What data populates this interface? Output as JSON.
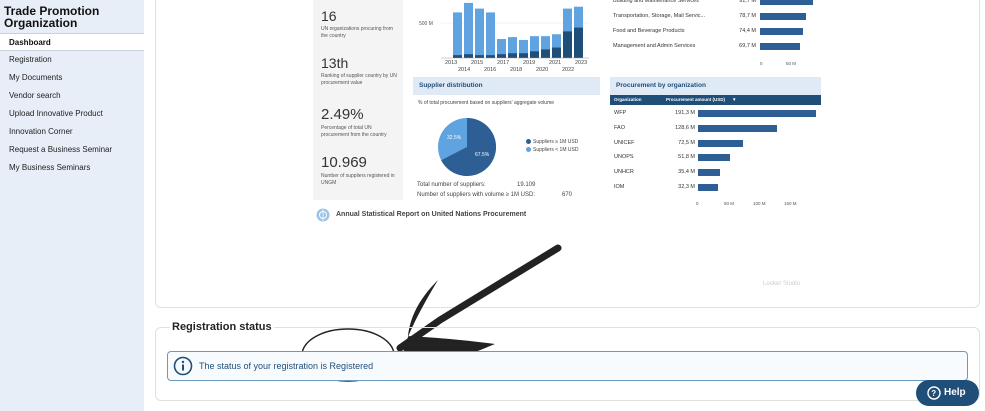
{
  "sidebar": {
    "org_title": "Trade Promotion Organization",
    "items": [
      {
        "label": "Dashboard",
        "active": true
      },
      {
        "label": "Registration"
      },
      {
        "label": "My Documents"
      },
      {
        "label": "Vendor search"
      },
      {
        "label": "Upload Innovative Product"
      },
      {
        "label": "Innovation Corner"
      },
      {
        "label": "Request a Business Seminar"
      },
      {
        "label": "My Business Seminars"
      }
    ]
  },
  "kpis": [
    {
      "value": "16",
      "desc": "UN organizations procuring from the country"
    },
    {
      "value": "13th",
      "desc": "Ranking of supplier country by UN procurement value"
    },
    {
      "value": "2.49%",
      "desc": "Percentage of total UN procurement from the country"
    },
    {
      "value": "10.969",
      "desc": "Number of suppliers registered in UNGM"
    }
  ],
  "year_chart": {
    "y_tick": "500 M",
    "x_top": [
      "2013",
      "2015",
      "2017",
      "2019",
      "2021",
      "2023"
    ],
    "x_bottom": [
      "2014",
      "2016",
      "2018",
      "2020",
      "2022"
    ]
  },
  "supplier_distribution": {
    "title": "Supplier distribution",
    "subtitle": "% of total procurement based on suppliers' aggregate volume",
    "pie_small": "32.5%",
    "pie_large": "67.5%",
    "legend": [
      "Suppliers ≥ 1M USD",
      "Suppliers < 1M USD"
    ],
    "total_label": "Total number of suppliers:",
    "total_value": "19.109",
    "over_label": "Number of suppliers with volume ≥ 1M USD:",
    "over_value": "670",
    "colors": {
      "large": "#2d5e94",
      "small": "#5fa3e0"
    }
  },
  "categories_chart": {
    "rows": [
      {
        "label": "Building and Maintenance Services",
        "value": "91,7 M",
        "num": 91.7
      },
      {
        "label": "Transportation, Storage, Mail Servic...",
        "value": "78,7 M",
        "num": 78.7
      },
      {
        "label": "Food and Beverage Products",
        "value": "74,4 M",
        "num": 74.4
      },
      {
        "label": "Management and Admin Services",
        "value": "69,7 M",
        "num": 69.7
      }
    ],
    "ticks": [
      "0",
      "50 M"
    ]
  },
  "org_chart": {
    "title": "Procurement by organization",
    "col_org": "Organization",
    "col_amount": "Procurement amount (USD)",
    "rows": [
      {
        "label": "WFP",
        "value": "191,3 M",
        "num": 191.3
      },
      {
        "label": "FAO",
        "value": "128,6 M",
        "num": 128.6
      },
      {
        "label": "UNICEF",
        "value": "72,5 M",
        "num": 72.5
      },
      {
        "label": "UNOPS",
        "value": "51,8 M",
        "num": 51.8
      },
      {
        "label": "UNHCR",
        "value": "35,4 M",
        "num": 35.4
      },
      {
        "label": "IOM",
        "value": "32,3 M",
        "num": 32.3
      }
    ],
    "ticks": [
      "0",
      "50 M",
      "100 M",
      "150 M"
    ]
  },
  "report_footer": "Annual Statistical Report on United Nations Procurement",
  "watermark": "Looker Studio",
  "registration": {
    "title": "Registration status",
    "message": "The status of your registration is Registered"
  },
  "help": {
    "label": "Help"
  }
}
